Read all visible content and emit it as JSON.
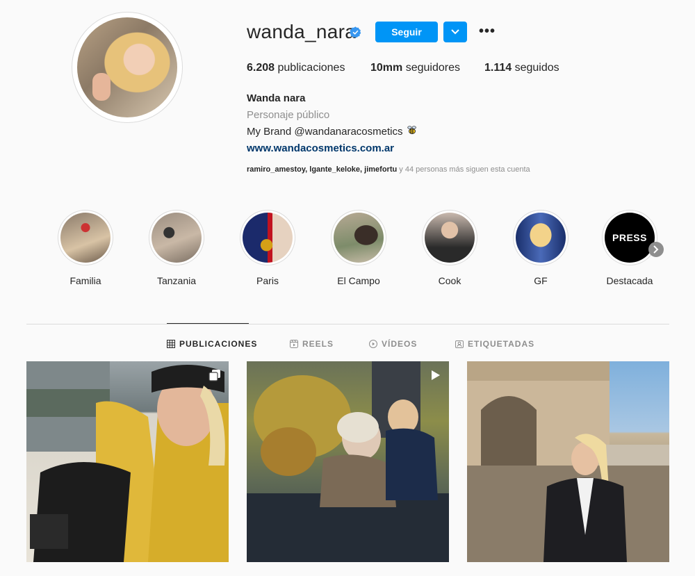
{
  "profile": {
    "username": "wanda_nara",
    "follow_label": "Seguir",
    "more_label": "•••",
    "stats": {
      "posts_count": "6.208",
      "posts_label": "publicaciones",
      "followers_count": "10mm",
      "followers_label": "seguidores",
      "following_count": "1.114",
      "following_label": "seguidos"
    },
    "bio": {
      "name": "Wanda nara",
      "category": "Personaje público",
      "brand_line": "My Brand @wandanaracosmetics",
      "website": "www.wandacosmetics.com.ar"
    },
    "followed_by": {
      "users": "ramiro_amestoy, lgante_keloke, jimefortu",
      "suffix": "y 44 personas más siguen esta cuenta"
    }
  },
  "highlights": [
    {
      "label": "Familia"
    },
    {
      "label": "Tanzania"
    },
    {
      "label": "Paris"
    },
    {
      "label": "El Campo"
    },
    {
      "label": "Cook"
    },
    {
      "label": "GF"
    },
    {
      "label": "Destacada",
      "cover_text": "PRESS"
    }
  ],
  "tabs": [
    {
      "label": "PUBLICACIONES",
      "icon": "grid-icon",
      "active": true
    },
    {
      "label": "REELS",
      "icon": "reels-icon",
      "active": false
    },
    {
      "label": "VÍDEOS",
      "icon": "play-circle-icon",
      "active": false
    },
    {
      "label": "ETIQUETADAS",
      "icon": "tagged-icon",
      "active": false
    }
  ],
  "posts": [
    {
      "type": "carousel",
      "badge_icon": "carousel-icon"
    },
    {
      "type": "video",
      "badge_icon": "play-icon"
    },
    {
      "type": "image",
      "badge_icon": ""
    }
  ],
  "colors": {
    "accent": "#0095f6",
    "link": "#00376b",
    "muted": "#8e8e8e",
    "text": "#262626",
    "background": "#fafafa"
  }
}
